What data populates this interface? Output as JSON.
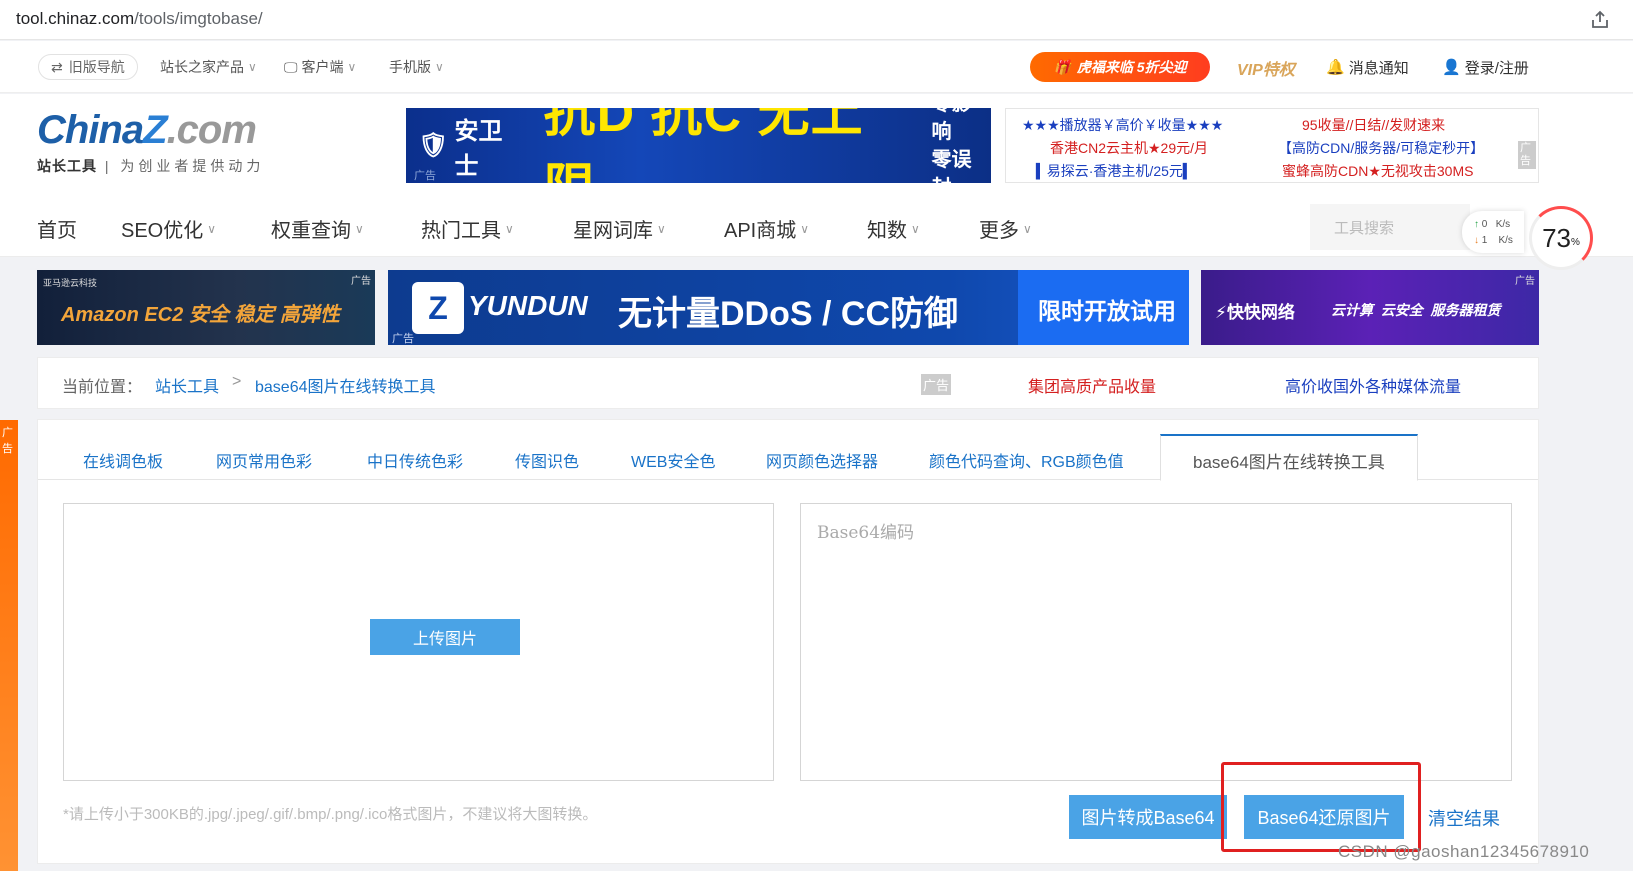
{
  "browser": {
    "url_host": "tool.chinaz.com",
    "url_path": "/tools/imgtobase/"
  },
  "topbar": {
    "old_nav": "旧版导航",
    "products": "站长之家产品",
    "client": "客户端",
    "mobile": "手机版",
    "promo": "虎福来临 5折尖迎",
    "vip": "VIP特权",
    "notify": "消息通知",
    "login": "登录/注册"
  },
  "logo": {
    "main_a": "China",
    "main_z": "Z",
    "main_b": ".com",
    "sub_bold": "站长工具",
    "sub": "| 为创业者提供动力"
  },
  "ad1": {
    "brand": "安卫士",
    "big": "抗D 抗C 无上限",
    "line1": "零影响",
    "line2": "零误封",
    "tag": "广告"
  },
  "adtext": {
    "l1": "★★★播放器￥高价￥收量★★★",
    "l2": "香港CN2云主机★29元/月",
    "l3": "▍易探云·香港主机/25元▍",
    "r1": "95收量//日结//发财速来",
    "r2": "【高防CDN/服务器/可稳定秒开】",
    "r3": "蜜蜂高防CDN★无视攻击30MS",
    "tag": "广告"
  },
  "nav": [
    "首页",
    "SEO优化",
    "权重查询",
    "热门工具",
    "星网词库",
    "API商城",
    "知数",
    "更多"
  ],
  "search": {
    "placeholder": "工具搜索"
  },
  "speed": {
    "up": "0",
    "down": "1",
    "unit": "K/s",
    "meter": "73",
    "meter_unit": "%"
  },
  "banners": {
    "b1_small": "亚马逊云科技",
    "b1_text": "Amazon EC2 安全 稳定 高弹性",
    "b2_brand": "YUNDUN",
    "b2_text": "无计量DDoS / CC防御",
    "b2_cta": "限时开放试用",
    "b3_brand": "快快网络",
    "b3_text": "云计算  云安全  服务器租赁",
    "tag": "广告"
  },
  "crumb": {
    "label": "当前位置：",
    "home": "站长工具",
    "sep": ">",
    "current": "base64图片在线转换工具",
    "ad": "广告",
    "ad1": "集团高质产品收量",
    "ad2": "高价收国外各种媒体流量"
  },
  "tabs": [
    "在线调色板",
    "网页常用色彩",
    "中日传统色彩",
    "传图识色",
    "WEB安全色",
    "网页颜色选择器",
    "颜色代码查询、RGB颜色值",
    "base64图片在线转换工具"
  ],
  "tool": {
    "upload": "上传图片",
    "placeholder": "Base64编码",
    "hint": "*请上传小于300KB的.jpg/.jpeg/.gif/.bmp/.png/.ico格式图片，不建议将大图转换。",
    "to_base64": "图片转成Base64",
    "to_image": "Base64还原图片",
    "clear": "清空结果"
  },
  "watermark": "CSDN @gaoshan12345678910",
  "side_tag": "广告",
  "colors": {
    "accent": "#1a73c8",
    "button": "#4aa3e6",
    "highlight": "#e02020"
  }
}
